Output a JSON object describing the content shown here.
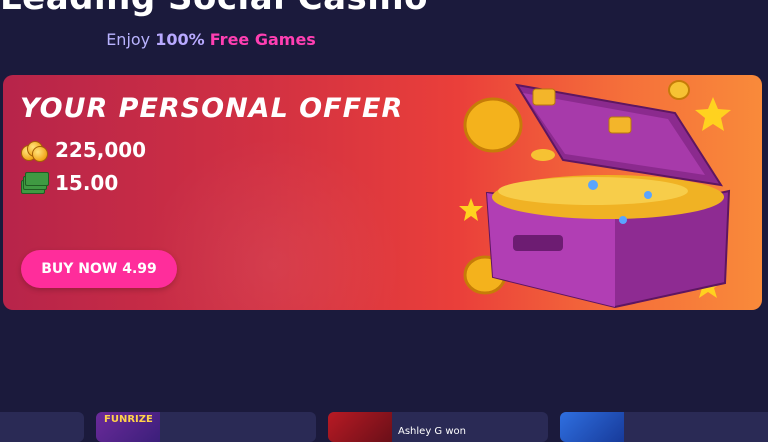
{
  "hero": {
    "title": "Leading Social Casino",
    "subtitle_prefix": "Enjoy ",
    "subtitle_percent": "100%",
    "subtitle_free": "Free Games"
  },
  "banner": {
    "title": "YOUR PERSONAL OFFER",
    "coins_value": "225,000",
    "cash_value": "15.00",
    "buy_label": "BUY NOW 4.99",
    "coin_icon": "gold-coins-icon",
    "cash_icon": "cash-bills-icon",
    "image": "treasure-chest-illustration"
  },
  "carousel": {
    "slide_count": 7,
    "active_index": 0
  },
  "cards": [
    {
      "text": ""
    },
    {
      "text": "FUNRIZE"
    },
    {
      "text": "Ashley G won"
    },
    {
      "text": ""
    }
  ],
  "colors": {
    "background": "#1b1a3c",
    "accent_pink": "#ff2d9b",
    "subtitle": "#b9b3ff",
    "banner_left": "#b7244a",
    "banner_right": "#f98a3a"
  }
}
